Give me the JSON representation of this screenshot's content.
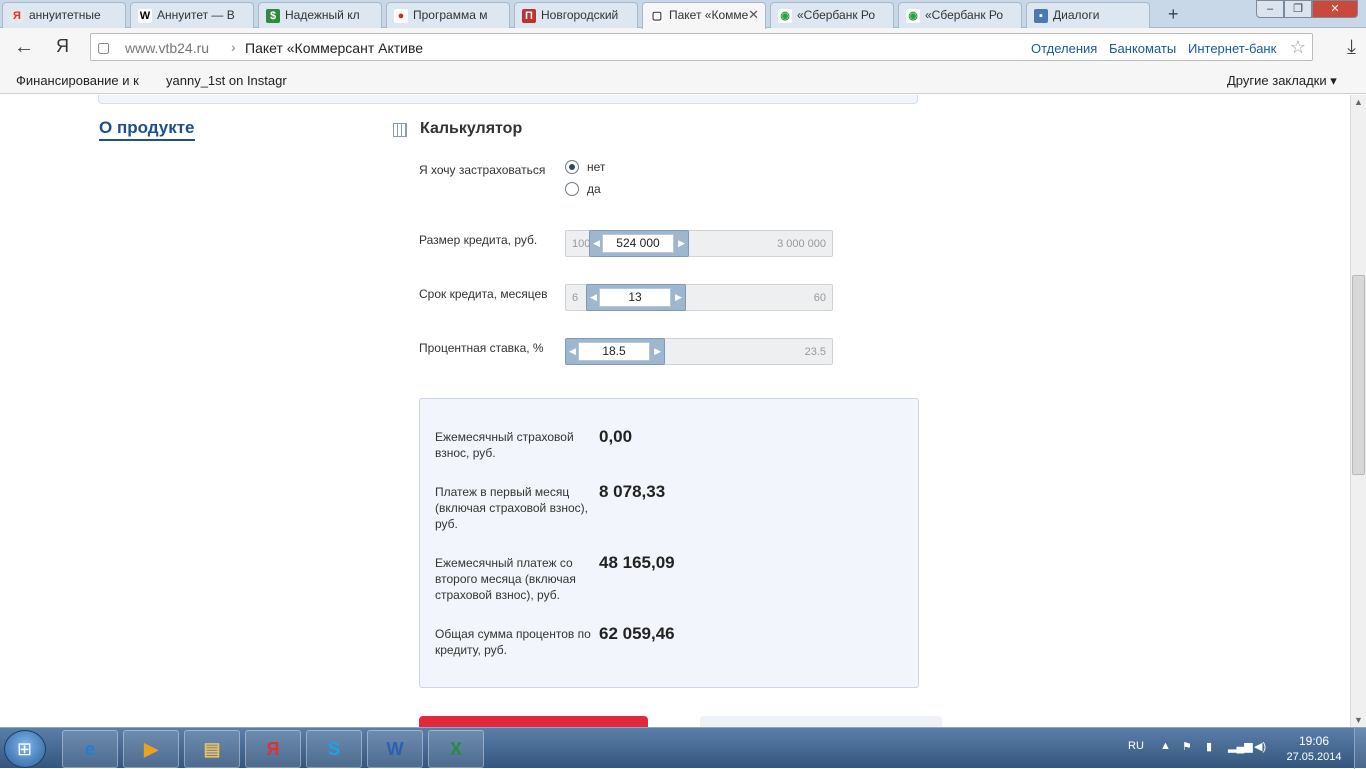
{
  "browser": {
    "tabs": [
      {
        "title": "аннуитетные",
        "fav": "Я",
        "fav_color": "#e8e8e8",
        "fav_text": "#e03030"
      },
      {
        "title": "Аннуитет — В",
        "fav": "W",
        "fav_color": "#ffffff",
        "fav_text": "#000000"
      },
      {
        "title": "Надежный кл",
        "fav": "$",
        "fav_color": "#2e8b3e",
        "fav_text": "#ffffff"
      },
      {
        "title": "Программа м",
        "fav": "●",
        "fav_color": "#ffffff",
        "fav_text": "#d02828"
      },
      {
        "title": "Новгородский",
        "fav": "П",
        "fav_color": "#c03030",
        "fav_text": "#ffffff"
      },
      {
        "title": "Пакет «Комме",
        "fav": "▢",
        "fav_color": "#ffffff",
        "fav_text": "#333333",
        "active": true
      },
      {
        "title": "«Сбербанк Ро",
        "fav": "◉",
        "fav_color": "#ffffff",
        "fav_text": "#2ea043"
      },
      {
        "title": "«Сбербанк Ро",
        "fav": "◉",
        "fav_color": "#ffffff",
        "fav_text": "#2ea043"
      },
      {
        "title": "Диалоги",
        "fav": "▪",
        "fav_color": "#4a78b0",
        "fav_text": "#ffffff"
      }
    ],
    "new_tab": "+",
    "window_buttons": {
      "minimize": "–",
      "maximize": "❐",
      "close": "✕"
    },
    "back": "←",
    "yandex": "Я",
    "address": {
      "url": "www.vtb24.ru",
      "separator": "›",
      "page_title": "Пакет «Коммерсант Активе"
    },
    "quick_links": [
      "Отделения",
      "Банкоматы",
      "Интернет-банк"
    ],
    "bookmarks": [
      "Финансирование и к",
      "yanny_1st on Instagr"
    ],
    "other_bookmarks": "Другие закладки ▾"
  },
  "page": {
    "about_link": "О продукте",
    "calc_title": "Калькулятор",
    "insurance": {
      "label": "Я хочу застраховаться",
      "options": [
        "нет",
        "да"
      ],
      "selected": 0
    },
    "sliders": [
      {
        "label": "Размер кредита, руб.",
        "min": "100",
        "max": "3 000 000",
        "value": "524 000",
        "fraction": 0.17
      },
      {
        "label": "Срок кредита, месяцев",
        "min": "6",
        "max": "60",
        "value": "13",
        "fraction": 0.13
      },
      {
        "label": "Процентная ставка, %",
        "min": "",
        "max": "23.5",
        "value": "18.5",
        "fraction": 0.0
      }
    ],
    "results": [
      {
        "label": "Ежемесячный страховой взнос, руб.",
        "value": "0,00"
      },
      {
        "label": "Платеж в первый месяц (включая страховой взнос), руб.",
        "value": "8 078,33"
      },
      {
        "label": "Ежемесячный платеж со второго месяца (включая страховой взнос), руб.",
        "value": "48 165,09"
      },
      {
        "label": "Общая сумма процентов по кредиту, руб.",
        "value": "62 059,46"
      }
    ],
    "accent_color": "#e3283b"
  },
  "taskbar": {
    "apps": [
      "e",
      "▶",
      "▤",
      "Я",
      "S",
      "W",
      "X"
    ],
    "lang": "RU",
    "time": "19:06",
    "date": "27.05.2014"
  }
}
